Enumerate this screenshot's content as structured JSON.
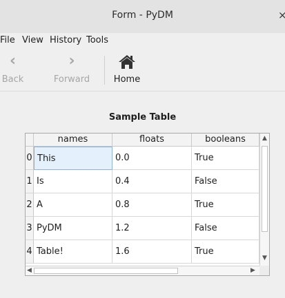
{
  "window": {
    "title": "Form - PyDM",
    "close_glyph": "×"
  },
  "menu": {
    "items": [
      "File",
      "View",
      "History",
      "Tools"
    ]
  },
  "toolbar": {
    "back": {
      "label": "Back",
      "icon": "chevron-left-icon",
      "glyph": "‹"
    },
    "forward": {
      "label": "Forward",
      "icon": "chevron-right-icon",
      "glyph": "›"
    },
    "home": {
      "label": "Home",
      "icon": "home-icon",
      "glyph": "⌂"
    }
  },
  "table": {
    "title": "Sample Table",
    "columns": [
      "names",
      "floats",
      "booleans"
    ],
    "rows": [
      {
        "index": "0",
        "cells": [
          "This",
          "0.0",
          "True"
        ]
      },
      {
        "index": "1",
        "cells": [
          "Is",
          "0.4",
          "False"
        ]
      },
      {
        "index": "2",
        "cells": [
          "A",
          "0.8",
          "True"
        ]
      },
      {
        "index": "3",
        "cells": [
          "PyDM",
          "1.2",
          "False"
        ]
      },
      {
        "index": "4",
        "cells": [
          "Table!",
          "1.6",
          "True"
        ]
      }
    ],
    "scroll_glyphs": {
      "up": "▲",
      "down": "▼",
      "left": "◀",
      "right": "▶"
    }
  },
  "colors": {
    "selection": "#e4f0fb",
    "window_bg": "#efefef"
  }
}
